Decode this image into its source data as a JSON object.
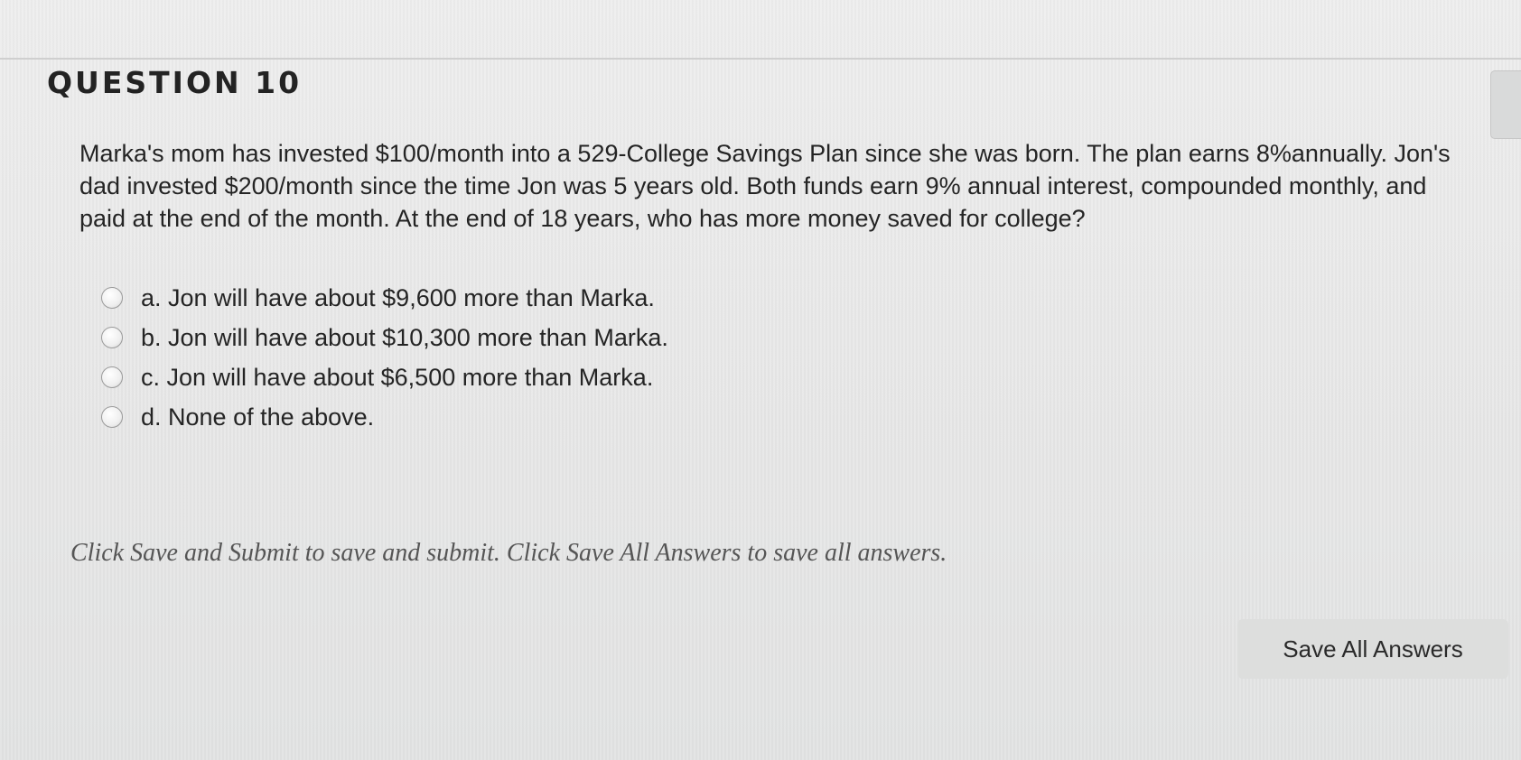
{
  "question": {
    "title": "QUESTION 10",
    "text": "Marka's mom has invested $100/month into a 529-College Savings Plan since she was born. The plan earns 8%annually. Jon's dad invested $200/month since the time Jon was 5 years old. Both funds earn 9% annual interest, compounded monthly, and paid at the end of the month. At the end of 18 years, who has more money saved for college?",
    "options": [
      {
        "label": "a. Jon will have about $9,600 more than Marka."
      },
      {
        "label": "b. Jon will have about $10,300 more than Marka."
      },
      {
        "label": "c. Jon will have about $6,500 more than Marka."
      },
      {
        "label": "d. None of the above."
      }
    ]
  },
  "footer": {
    "instructions": "Click Save and Submit to save and submit. Click Save All Answers to save all answers.",
    "save_all_label": "Save All Answers"
  }
}
